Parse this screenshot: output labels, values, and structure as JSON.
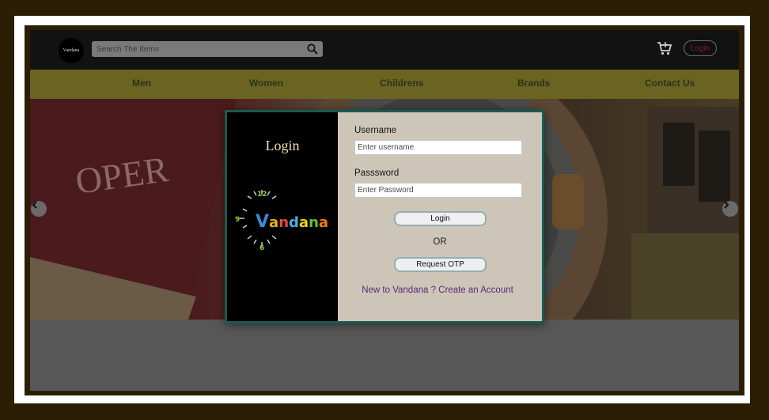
{
  "header": {
    "logo_text": "Vandana",
    "search_placeholder": "Search The Items",
    "login_label": "Login"
  },
  "nav": {
    "items": [
      {
        "label": "Men"
      },
      {
        "label": "Women"
      },
      {
        "label": "Childrens"
      },
      {
        "label": "Brands"
      },
      {
        "label": "Contact Us"
      }
    ]
  },
  "hero": {
    "book_text": "OPER"
  },
  "modal": {
    "title": "Login",
    "logo_text": "Vandana",
    "clock_numbers": [
      "12",
      "9",
      "6"
    ],
    "username_label": "Username",
    "username_placeholder": "Enter username",
    "password_label": "Passsword",
    "password_placeholder": "Enter Password",
    "login_button": "Login",
    "or_text": "OR",
    "otp_button": "Request OTP",
    "create_account_link": "New to Vandana ? Create an Account"
  },
  "icons": {
    "search": "search-icon",
    "cart": "cart-icon",
    "prev": "chevron-left-icon",
    "next": "chevron-right-icon"
  },
  "colors": {
    "nav_bg": "#6b6322",
    "modal_border": "#1a5a52",
    "link": "#5a2a78"
  }
}
